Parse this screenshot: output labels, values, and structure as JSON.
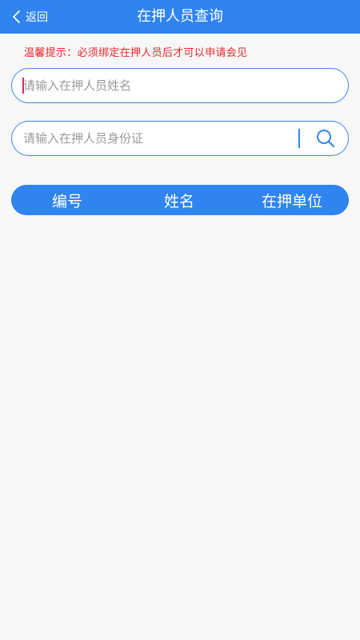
{
  "header": {
    "back_label": "返回",
    "title": "在押人员查询",
    "color": "#2f84f0"
  },
  "notice": "温馨提示：必须绑定在押人员后才可以申请会见",
  "search": {
    "name_placeholder": "请输入在押人员姓名",
    "name_value": "",
    "id_placeholder": "请输入在押人员身份证",
    "id_value": "",
    "icon": "search-icon"
  },
  "table": {
    "columns": [
      "编号",
      "姓名",
      "在押单位"
    ],
    "rows": []
  },
  "colors": {
    "accent": "#2f84f0",
    "warning": "#e8262a",
    "background": "#f7f7f7"
  }
}
